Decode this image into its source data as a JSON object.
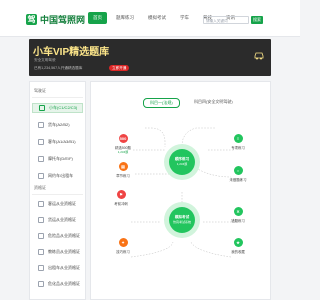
{
  "brand": {
    "name": "中国驾照网",
    "mark": "驾"
  },
  "nav": {
    "items": [
      "首页",
      "题库练习",
      "模拟考试",
      "学车",
      "驾校",
      "资讯"
    ],
    "active": 0
  },
  "search": {
    "placeholder": "请输入关键词",
    "button": "搜索"
  },
  "banner": {
    "title": "小车VIP精选题库",
    "subtitle": "安全文明驾驶",
    "info": "已有1,234,567人开通精选题库",
    "badge": "立即开通"
  },
  "sidebar": {
    "section1_title": "驾驶证",
    "items1": [
      "小车(C1/C2/C3)",
      "货车(A2/B2)",
      "客车(A1/A3/B1)",
      "摩托车(D/E/F)",
      "网约车/出租车"
    ],
    "active_index": 0,
    "section2_title": "资格证",
    "items2": [
      "客运从业资格证",
      "货运从业资格证",
      "危险品从业资格证",
      "教练员从业资格证",
      "出租车从业资格证",
      "危化品从业资格证"
    ]
  },
  "tabs": [
    "科目一(法规)",
    "科目四(安全文明驾驶)"
  ],
  "active_tab": 0,
  "hubs": [
    {
      "title": "顺序练习",
      "sub": "1,234题"
    },
    {
      "title": "模拟考试",
      "sub": "仿真考试系统"
    }
  ],
  "nodes": [
    {
      "label": "精选500题",
      "sub": "1,234题",
      "badge": "500",
      "color": "#ef4444"
    },
    {
      "label": "专项练习",
      "sub": "",
      "badge": "",
      "color": "#22c55e"
    },
    {
      "label": "章节练习",
      "sub": "",
      "badge": "",
      "color": "#f97316"
    },
    {
      "label": "未做题练习",
      "sub": "",
      "badge": "",
      "color": "#22c55e"
    },
    {
      "label": "考前冲刺",
      "sub": "",
      "badge": "",
      "color": "#ef4444"
    },
    {
      "label": "错题练习",
      "sub": "",
      "badge": "",
      "color": "#22c55e"
    },
    {
      "label": "技巧练习",
      "sub": "",
      "badge": "",
      "color": "#f97316"
    },
    {
      "label": "我的收藏",
      "sub": "",
      "badge": "",
      "color": "#22c55e"
    }
  ]
}
